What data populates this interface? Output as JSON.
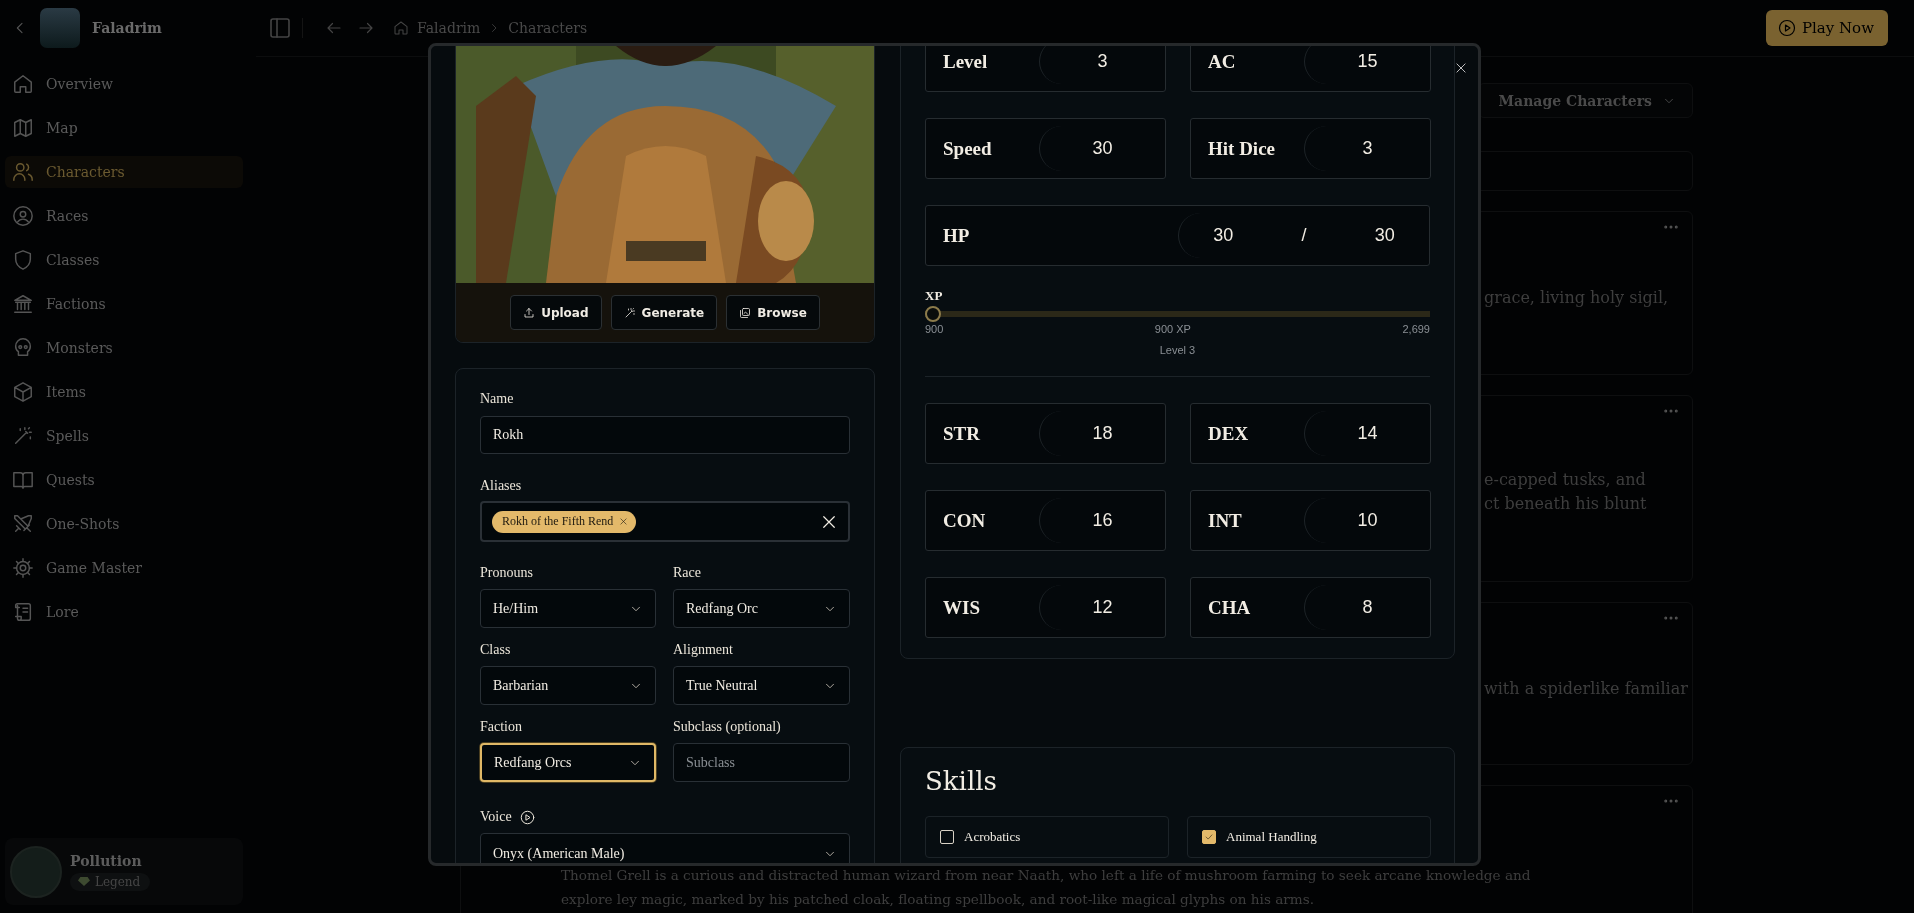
{
  "sidebar": {
    "app_name": "Faladrim",
    "items": [
      {
        "label": "Overview",
        "selected": false
      },
      {
        "label": "Map",
        "selected": false
      },
      {
        "label": "Characters",
        "selected": true
      },
      {
        "label": "Races",
        "selected": false
      },
      {
        "label": "Classes",
        "selected": false
      },
      {
        "label": "Factions",
        "selected": false
      },
      {
        "label": "Monsters",
        "selected": false
      },
      {
        "label": "Items",
        "selected": false
      },
      {
        "label": "Spells",
        "selected": false
      },
      {
        "label": "Quests",
        "selected": false
      },
      {
        "label": "One-Shots",
        "selected": false
      },
      {
        "label": "Game Master",
        "selected": false
      },
      {
        "label": "Lore",
        "selected": false
      }
    ],
    "user": {
      "name": "Pollution",
      "badge": "Legend"
    }
  },
  "topbar": {
    "breadcrumbs": [
      "Faladrim",
      "Characters"
    ],
    "play_button": "Play Now"
  },
  "content": {
    "manage_button": "Manage Characters",
    "cards": [
      {
        "lines": [
          "grace, living holy sigil,"
        ]
      },
      {
        "lines": [
          "e-capped tusks, and",
          "ct beneath his blunt"
        ]
      },
      {
        "lines": [
          "with a spiderlike familiar"
        ]
      },
      {
        "lines": [
          "Thomel Grell is a curious and distracted human wizard from near Naath, who left a life of mushroom farming to seek arcane knowledge and",
          "explore ley magic, marked by his patched cloak, floating spellbook, and root-like magical glyphs on his arms."
        ]
      }
    ]
  },
  "modal": {
    "image_buttons": [
      "Upload",
      "Generate",
      "Browse"
    ],
    "name": {
      "label": "Name",
      "value": "Rokh"
    },
    "aliases": {
      "label": "Aliases",
      "chips": [
        "Rokh of the Fifth Rend"
      ]
    },
    "fields": [
      {
        "label": "Pronouns",
        "kind": "select",
        "value": "He/Him",
        "focused": false
      },
      {
        "label": "Race",
        "kind": "select",
        "value": "Redfang Orc",
        "focused": false
      },
      {
        "label": "Class",
        "kind": "select",
        "value": "Barbarian",
        "focused": false
      },
      {
        "label": "Alignment",
        "kind": "select",
        "value": "True Neutral",
        "focused": false
      },
      {
        "label": "Faction",
        "kind": "select",
        "value": "Redfang Orcs",
        "focused": true
      },
      {
        "label": "Subclass (optional)",
        "kind": "input",
        "placeholder": "Subclass",
        "focused": false
      }
    ],
    "voice": {
      "label": "Voice",
      "value": "Onyx (American Male)"
    },
    "stats": [
      {
        "label": "Level",
        "value": "3"
      },
      {
        "label": "AC",
        "value": "15"
      },
      {
        "label": "Speed",
        "value": "30"
      },
      {
        "label": "Hit Dice",
        "value": "3"
      }
    ],
    "hp": {
      "label": "HP",
      "current": "30",
      "separator": "/",
      "max": "30"
    },
    "xp": {
      "label": "XP",
      "level": 0,
      "min": "900",
      "reading": "900 XP",
      "max": "2,699",
      "caption": "Level 3"
    },
    "abilities": [
      {
        "label": "STR",
        "value": "18"
      },
      {
        "label": "DEX",
        "value": "14"
      },
      {
        "label": "CON",
        "value": "16"
      },
      {
        "label": "INT",
        "value": "10"
      },
      {
        "label": "WIS",
        "value": "12"
      },
      {
        "label": "CHA",
        "value": "8"
      }
    ],
    "skills": {
      "title": "Skills",
      "items": [
        {
          "label": "Acrobatics",
          "checked": false
        },
        {
          "label": "Animal Handling",
          "checked": true
        }
      ]
    }
  }
}
